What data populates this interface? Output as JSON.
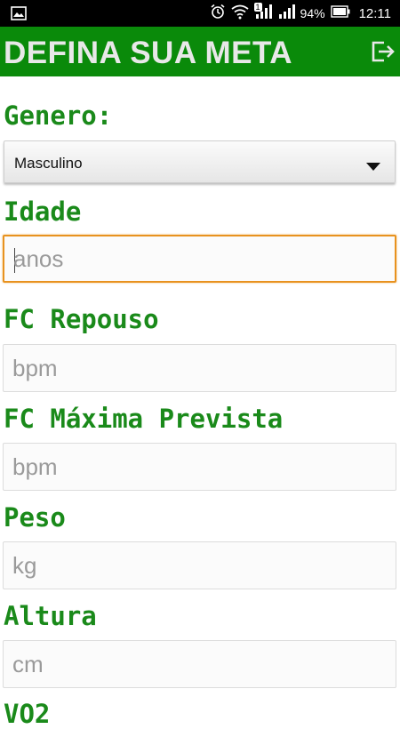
{
  "status_bar": {
    "battery_percent": "94%",
    "time": "12:11",
    "notification_badge": "1"
  },
  "app_bar": {
    "title": "DEFINA SUA META",
    "exit_icon": "exit-icon"
  },
  "form": {
    "genero": {
      "label": "Genero:",
      "selected": "Masculino"
    },
    "idade": {
      "label": "Idade",
      "placeholder": "anos",
      "value": ""
    },
    "fc_repouso": {
      "label": "FC Repouso",
      "placeholder": "bpm",
      "value": ""
    },
    "fc_maxima": {
      "label": "FC Máxima Prevista",
      "placeholder": "bpm",
      "value": ""
    },
    "peso": {
      "label": "Peso",
      "placeholder": "kg",
      "value": ""
    },
    "altura": {
      "label": "Altura",
      "placeholder": "cm",
      "value": ""
    },
    "next_label": "VO2"
  },
  "colors": {
    "app_bar": "#0a8a0a",
    "label_green": "#1a8a1a",
    "focus_orange": "#e8921f"
  }
}
